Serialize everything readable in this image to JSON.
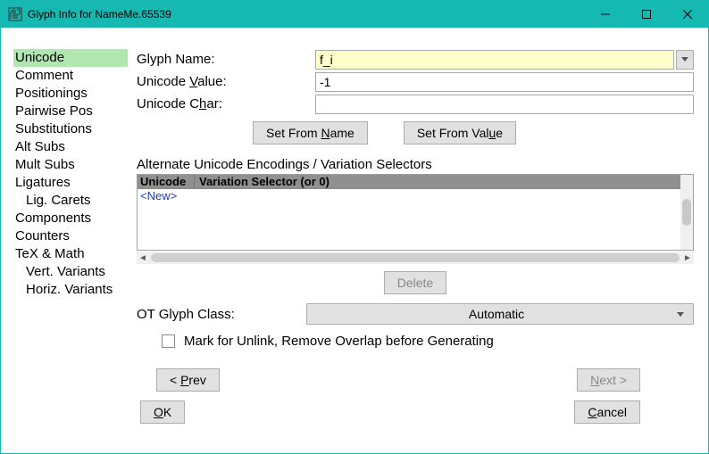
{
  "window": {
    "title": "Glyph Info for NameMe.65539"
  },
  "sidebar": {
    "items": [
      {
        "label": "Unicode",
        "selected": true
      },
      {
        "label": "Comment"
      },
      {
        "label": "Positionings"
      },
      {
        "label": "Pairwise Pos"
      },
      {
        "label": "Substitutions"
      },
      {
        "label": "Alt Subs"
      },
      {
        "label": "Mult Subs"
      },
      {
        "label": "Ligatures"
      },
      {
        "label": "Lig. Carets",
        "indent": true
      },
      {
        "label": "Components"
      },
      {
        "label": "Counters"
      },
      {
        "label": "TeX & Math"
      },
      {
        "label": "Vert. Variants",
        "indent": true
      },
      {
        "label": "Horiz. Variants",
        "indent": true
      }
    ]
  },
  "form": {
    "glyph_name_label": "Glyph Name:",
    "glyph_name_value": "f_i",
    "unicode_value_label_pre": "Unicode ",
    "unicode_value_label_u": "V",
    "unicode_value_label_post": "alue:",
    "unicode_value": "-1",
    "unicode_char_label_pre": "Unicode C",
    "unicode_char_label_u": "h",
    "unicode_char_label_post": "ar:",
    "unicode_char_value": ""
  },
  "buttons": {
    "set_from_name_pre": "Set From ",
    "set_from_name_u": "N",
    "set_from_name_post": "ame",
    "set_from_value_pre": "Set From Val",
    "set_from_value_u": "u",
    "set_from_value_post": "e",
    "delete": "Delete",
    "prev_pre": "< ",
    "prev_u": "P",
    "prev_post": "rev",
    "next_u": "N",
    "next_post": "ext >",
    "ok_u": "O",
    "ok_post": "K",
    "cancel_u": "C",
    "cancel_post": "ancel"
  },
  "alt": {
    "title": "Alternate Unicode Encodings / Variation Selectors",
    "col_unicode": "Unicode",
    "col_varsel": "Variation Selector (or 0)",
    "new_row": "<New>"
  },
  "ot": {
    "label": "OT Glyph Class:",
    "value": "Automatic"
  },
  "mark": {
    "label": "Mark for Unlink, Remove Overlap before Generating",
    "checked": false
  }
}
